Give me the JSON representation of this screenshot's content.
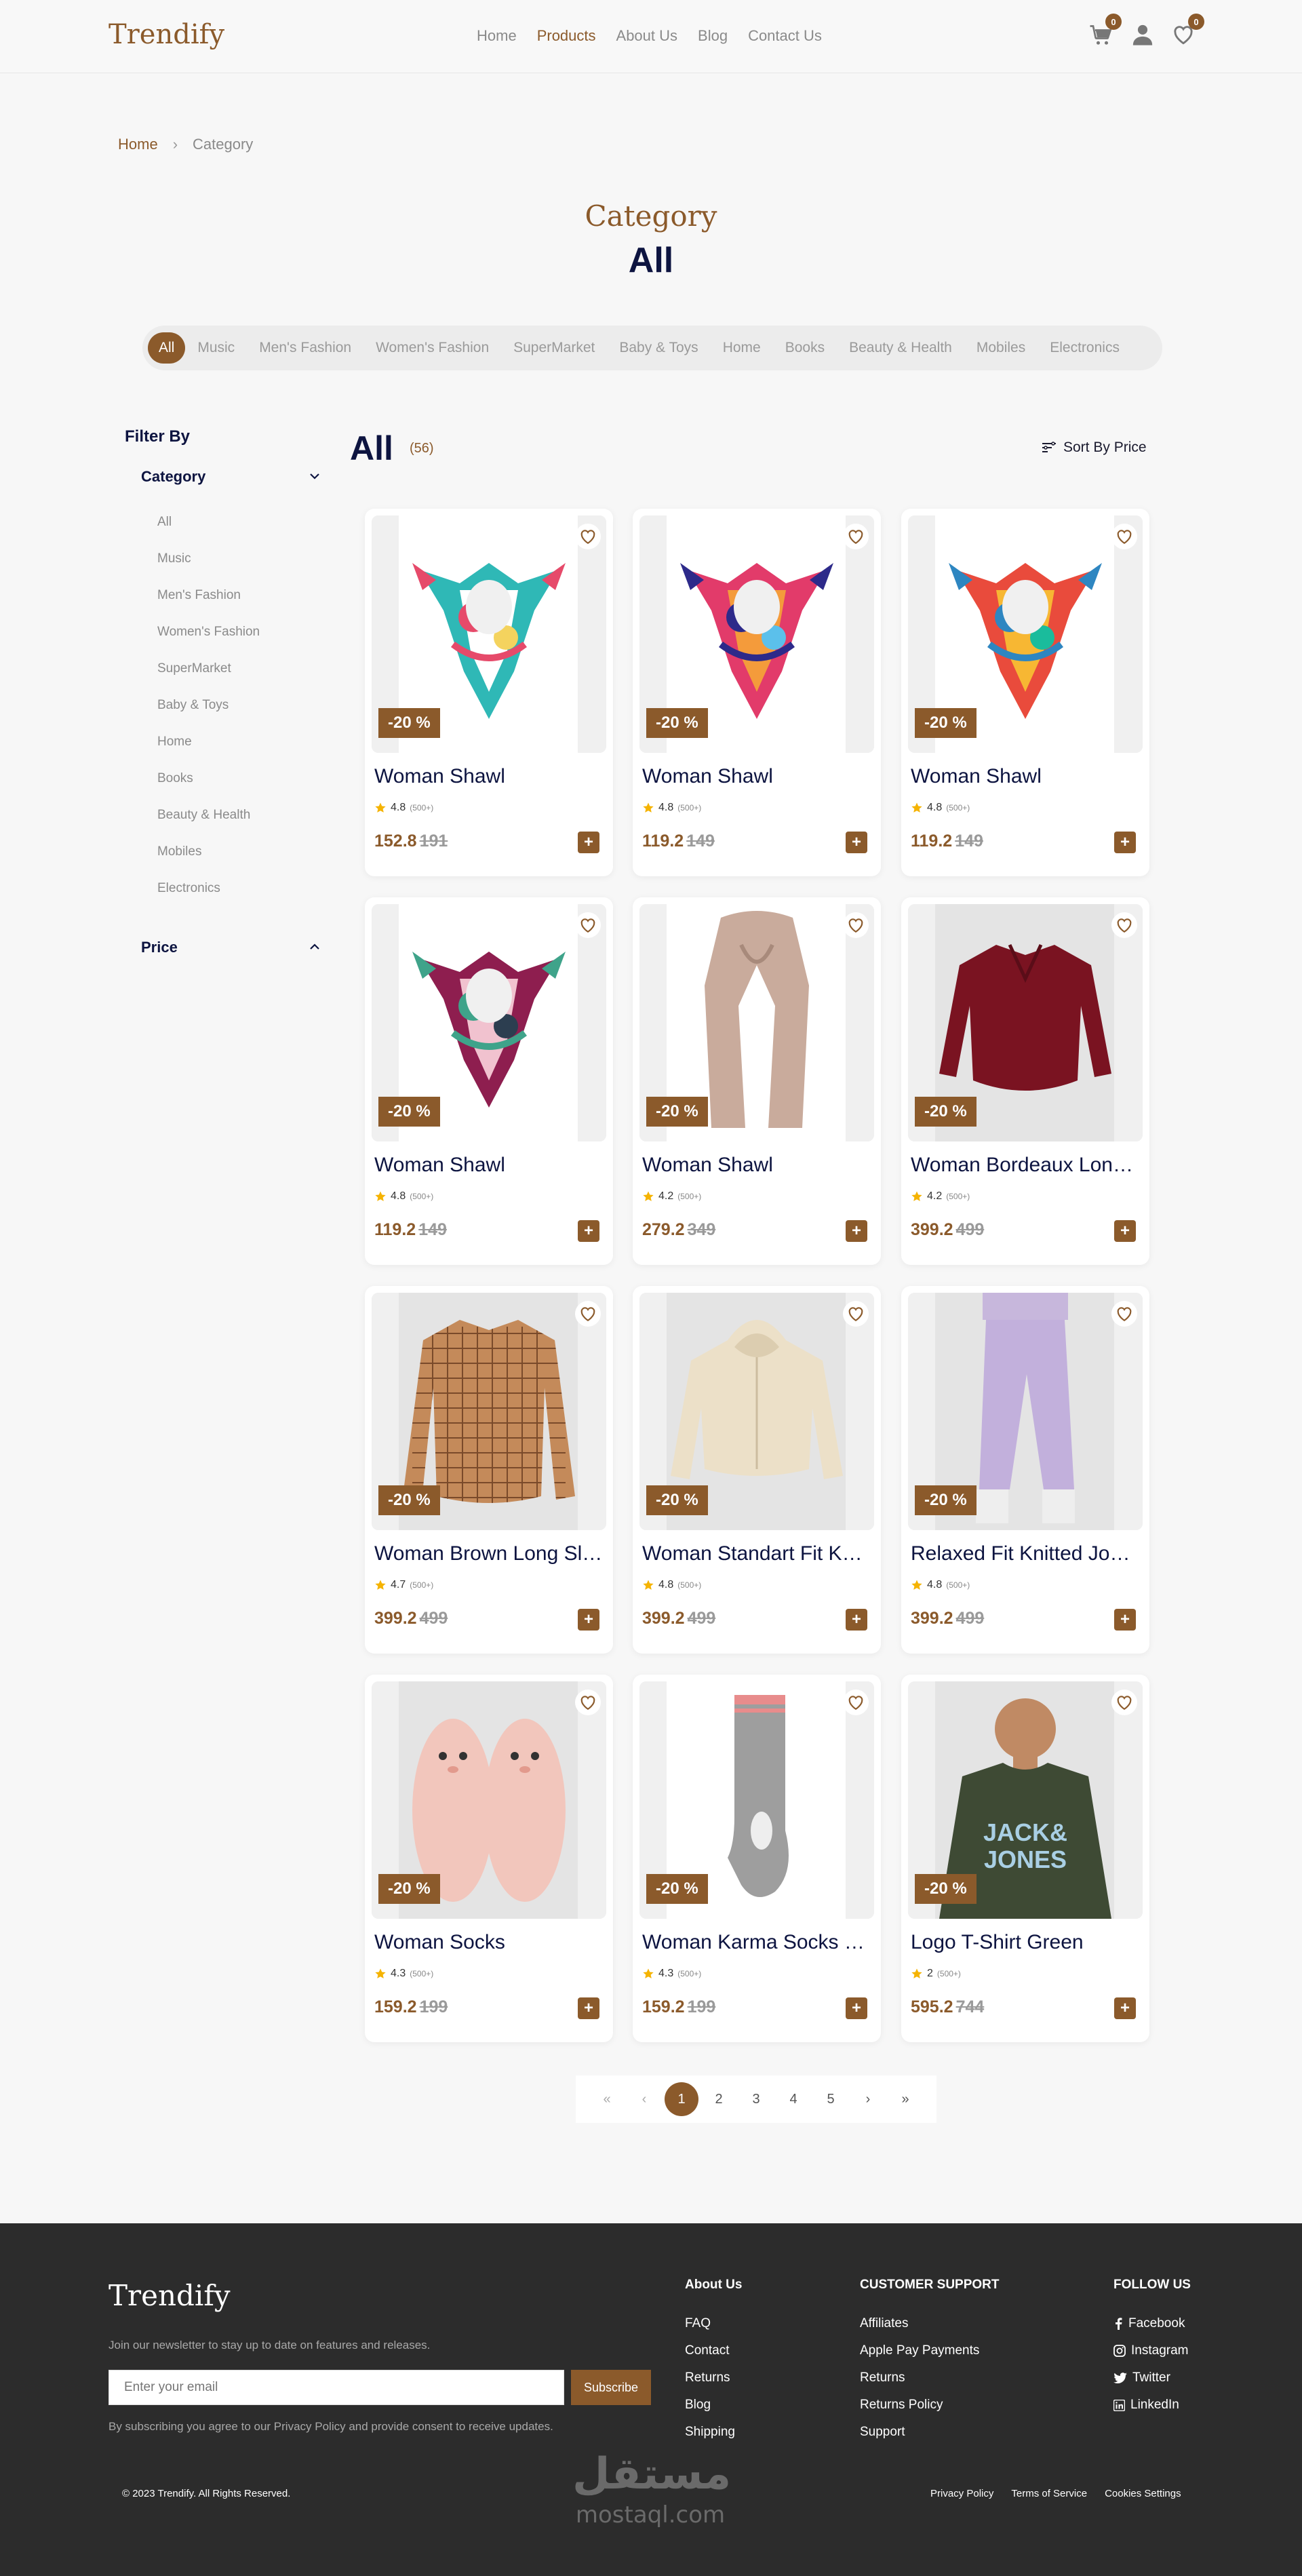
{
  "brand": "Trendify",
  "nav": [
    {
      "label": "Home"
    },
    {
      "label": "Products"
    },
    {
      "label": "About Us"
    },
    {
      "label": "Blog"
    },
    {
      "label": "Contact Us"
    }
  ],
  "header": {
    "cart_count": "0",
    "wishlist_count": "0"
  },
  "breadcrumb": {
    "home": "Home",
    "current": "Category"
  },
  "page": {
    "title": "Category",
    "subtitle": "All"
  },
  "categories": [
    "All",
    "Music",
    "Men's Fashion",
    "Women's Fashion",
    "SuperMarket",
    "Baby & Toys",
    "Home",
    "Books",
    "Beauty & Health",
    "Mobiles",
    "Electronics"
  ],
  "sidebar": {
    "filter_title": "Filter By",
    "category_label": "Category",
    "items": [
      "All",
      "Music",
      "Men's Fashion",
      "Women's Fashion",
      "SuperMarket",
      "Baby & Toys",
      "Home",
      "Books",
      "Beauty & Health",
      "Mobiles",
      "Electronics"
    ],
    "price_label": "Price"
  },
  "listing": {
    "title": "All",
    "count": "(56)",
    "sort_label": "Sort By Price"
  },
  "products": [
    {
      "name": "Woman Shawl",
      "discount": "-20 %",
      "rating": "4.8",
      "reviews": "(500+)",
      "price": "152.8",
      "old_price": "191",
      "image": "scarf-icon"
    },
    {
      "name": "Woman Shawl",
      "discount": "-20 %",
      "rating": "4.8",
      "reviews": "(500+)",
      "price": "119.2",
      "old_price": "149",
      "image": "scarf-icon"
    },
    {
      "name": "Woman Shawl",
      "discount": "-20 %",
      "rating": "4.8",
      "reviews": "(500+)",
      "price": "119.2",
      "old_price": "149",
      "image": "scarf-icon"
    },
    {
      "name": "Woman Shawl",
      "discount": "-20 %",
      "rating": "4.8",
      "reviews": "(500+)",
      "price": "119.2",
      "old_price": "149",
      "image": "scarf-icon"
    },
    {
      "name": "Woman Shawl",
      "discount": "-20 %",
      "rating": "4.2",
      "reviews": "(500+)",
      "price": "279.2",
      "old_price": "349",
      "image": "long-scarf-icon"
    },
    {
      "name": "Woman Bordeaux Long Sleeve Shirt",
      "discount": "-20 %",
      "rating": "4.2",
      "reviews": "(500+)",
      "price": "399.2",
      "old_price": "499",
      "image": "shirt-icon"
    },
    {
      "name": "Woman Brown Long Sleeve Shirt",
      "discount": "-20 %",
      "rating": "4.7",
      "reviews": "(500+)",
      "price": "399.2",
      "old_price": "499",
      "image": "plaid-shirt-icon"
    },
    {
      "name": "Woman Standart Fit Knitted Hoodie",
      "discount": "-20 %",
      "rating": "4.8",
      "reviews": "(500+)",
      "price": "399.2",
      "old_price": "499",
      "image": "hoodie-icon"
    },
    {
      "name": "Relaxed Fit Knitted Jogger",
      "discount": "-20 %",
      "rating": "4.8",
      "reviews": "(500+)",
      "price": "399.2",
      "old_price": "499",
      "image": "jogger-icon"
    },
    {
      "name": "Woman Socks",
      "discount": "-20 %",
      "rating": "4.3",
      "reviews": "(500+)",
      "price": "159.2",
      "old_price": "199",
      "image": "slipper-socks-icon"
    },
    {
      "name": "Woman Karma Socks Grey",
      "discount": "-20 %",
      "rating": "4.3",
      "reviews": "(500+)",
      "price": "159.2",
      "old_price": "199",
      "image": "sock-icon"
    },
    {
      "name": "Logo T-Shirt Green",
      "discount": "-20 %",
      "rating": "2",
      "reviews": "(500+)",
      "price": "595.2",
      "old_price": "744",
      "image": "tshirt-icon",
      "print_top": "JACK&",
      "print_bottom": "JONES"
    }
  ],
  "pagination": {
    "first": "«",
    "prev": "‹",
    "pages": [
      "1",
      "2",
      "3",
      "4",
      "5"
    ],
    "next": "›",
    "last": "»",
    "current": "1"
  },
  "footer": {
    "logo": "Trendify",
    "newsletter_text": "Join our newsletter to stay up to date on features and releases.",
    "email_placeholder": "Enter your email",
    "subscribe_label": "Subscribe",
    "legal_text": "By subscribing you agree to our Privacy Policy and provide consent to receive updates.",
    "about": {
      "title": "About Us",
      "links": [
        "FAQ",
        "Contact",
        "Returns",
        "Blog",
        "Shipping"
      ]
    },
    "support": {
      "title": "CUSTOMER SUPPORT",
      "links": [
        "Affiliates",
        "Apple Pay Payments",
        "Returns",
        "Returns Policy",
        "Support"
      ]
    },
    "follow": {
      "title": "FOLLOW US",
      "links": [
        "Facebook",
        "Instagram",
        "Twitter",
        "LinkedIn"
      ]
    },
    "copyright": "© 2023 Trendify. All Rights Reserved.",
    "bottom_links": [
      "Privacy Policy",
      "Terms of Service",
      "Cookies Settings"
    ],
    "watermark_ar": "مستقل",
    "watermark_latin": "mostaql.com"
  },
  "colors": {
    "accent": "#8b5a2b",
    "navy": "#0d1440",
    "footer_bg": "#2c2c2c"
  }
}
